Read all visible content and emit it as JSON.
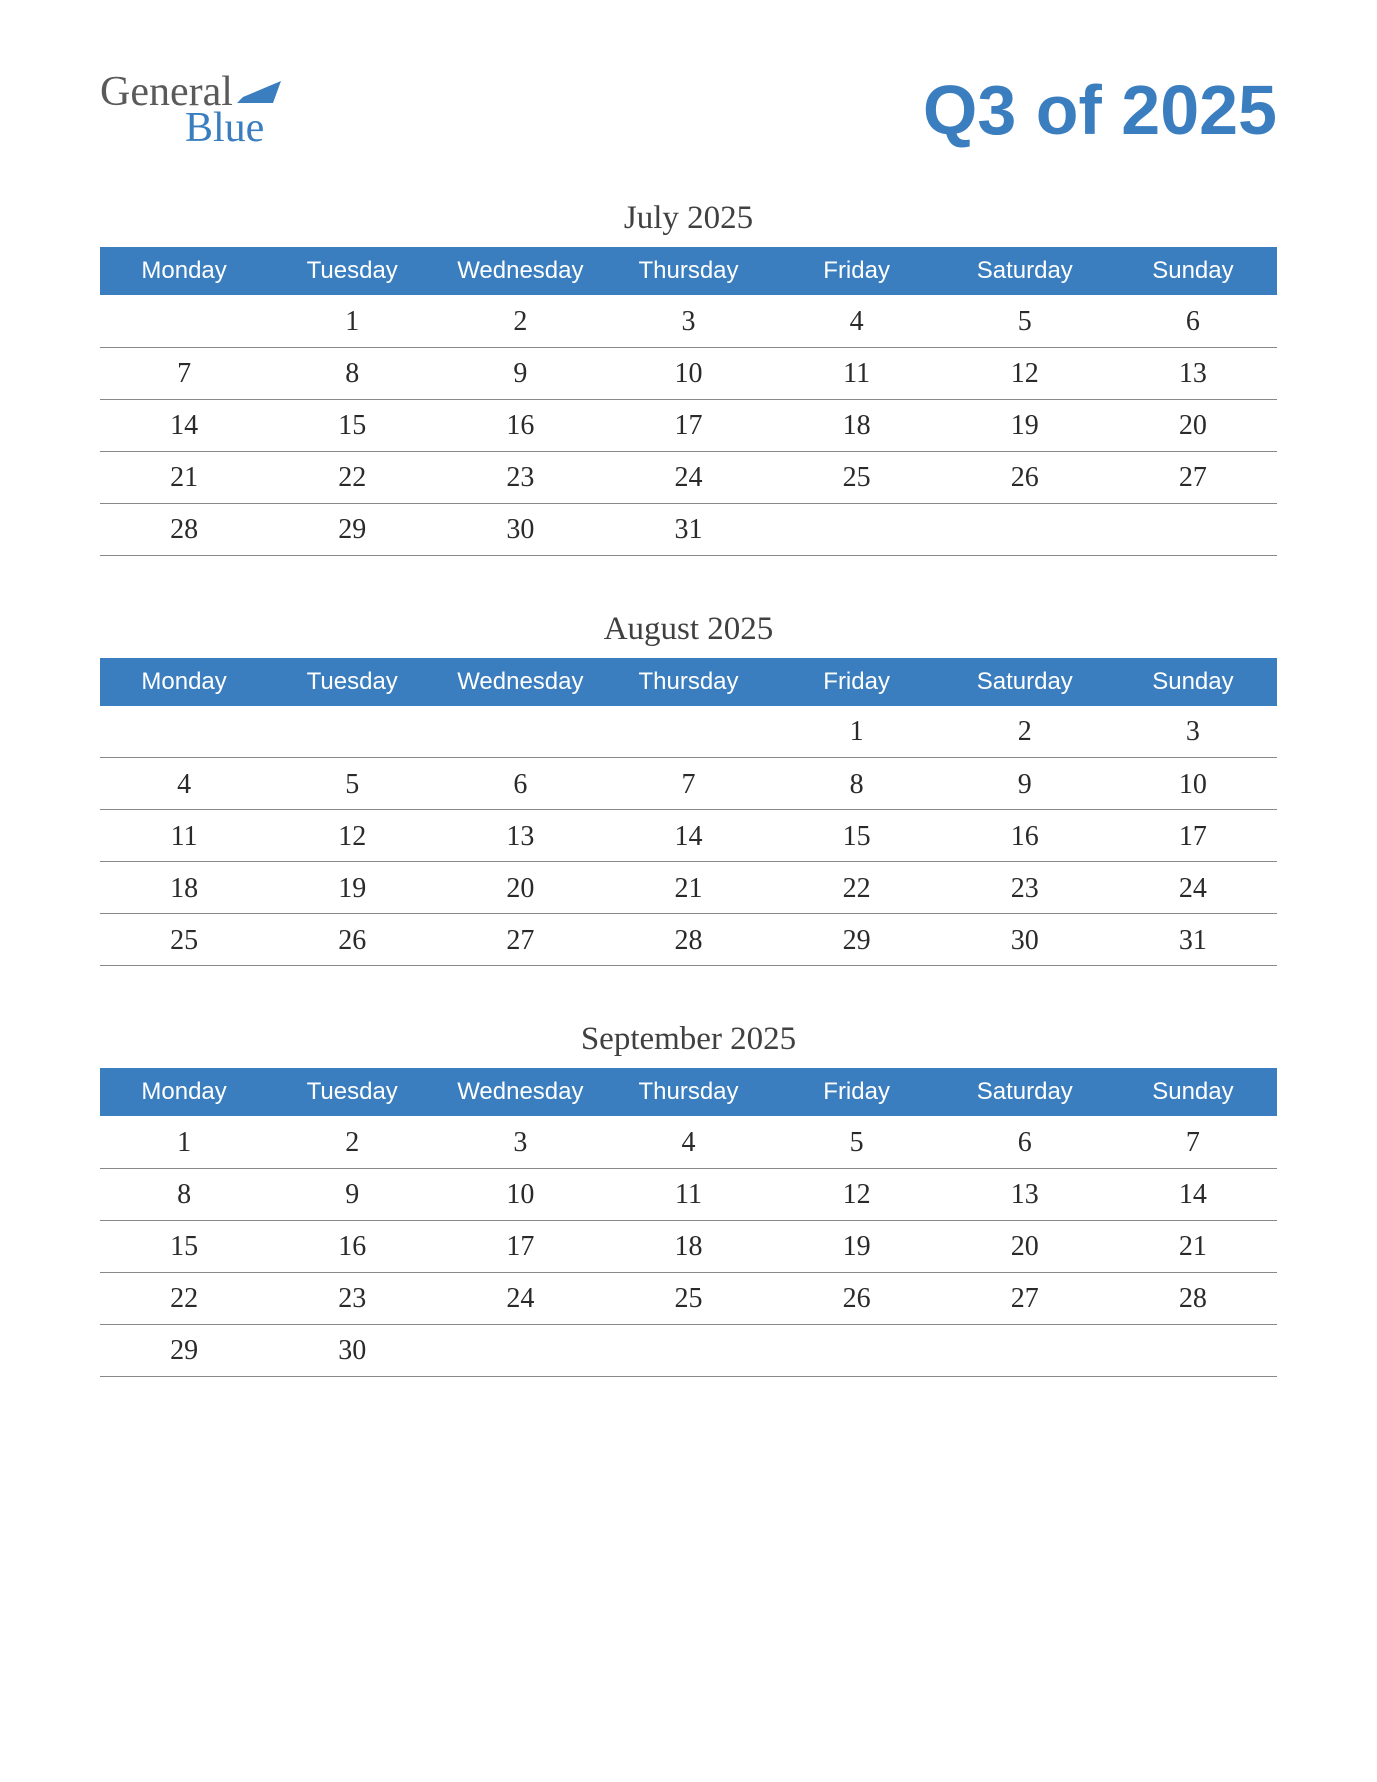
{
  "logo": {
    "word1": "General",
    "word2": "Blue"
  },
  "title": "Q3 of 2025",
  "weekdays": [
    "Monday",
    "Tuesday",
    "Wednesday",
    "Thursday",
    "Friday",
    "Saturday",
    "Sunday"
  ],
  "months": [
    {
      "title": "July 2025",
      "weeks": [
        [
          "",
          "1",
          "2",
          "3",
          "4",
          "5",
          "6"
        ],
        [
          "7",
          "8",
          "9",
          "10",
          "11",
          "12",
          "13"
        ],
        [
          "14",
          "15",
          "16",
          "17",
          "18",
          "19",
          "20"
        ],
        [
          "21",
          "22",
          "23",
          "24",
          "25",
          "26",
          "27"
        ],
        [
          "28",
          "29",
          "30",
          "31",
          "",
          "",
          ""
        ]
      ]
    },
    {
      "title": "August 2025",
      "weeks": [
        [
          "",
          "",
          "",
          "",
          "1",
          "2",
          "3"
        ],
        [
          "4",
          "5",
          "6",
          "7",
          "8",
          "9",
          "10"
        ],
        [
          "11",
          "12",
          "13",
          "14",
          "15",
          "16",
          "17"
        ],
        [
          "18",
          "19",
          "20",
          "21",
          "22",
          "23",
          "24"
        ],
        [
          "25",
          "26",
          "27",
          "28",
          "29",
          "30",
          "31"
        ]
      ]
    },
    {
      "title": "September 2025",
      "weeks": [
        [
          "1",
          "2",
          "3",
          "4",
          "5",
          "6",
          "7"
        ],
        [
          "8",
          "9",
          "10",
          "11",
          "12",
          "13",
          "14"
        ],
        [
          "15",
          "16",
          "17",
          "18",
          "19",
          "20",
          "21"
        ],
        [
          "22",
          "23",
          "24",
          "25",
          "26",
          "27",
          "28"
        ],
        [
          "29",
          "30",
          "",
          "",
          "",
          "",
          ""
        ]
      ]
    }
  ]
}
